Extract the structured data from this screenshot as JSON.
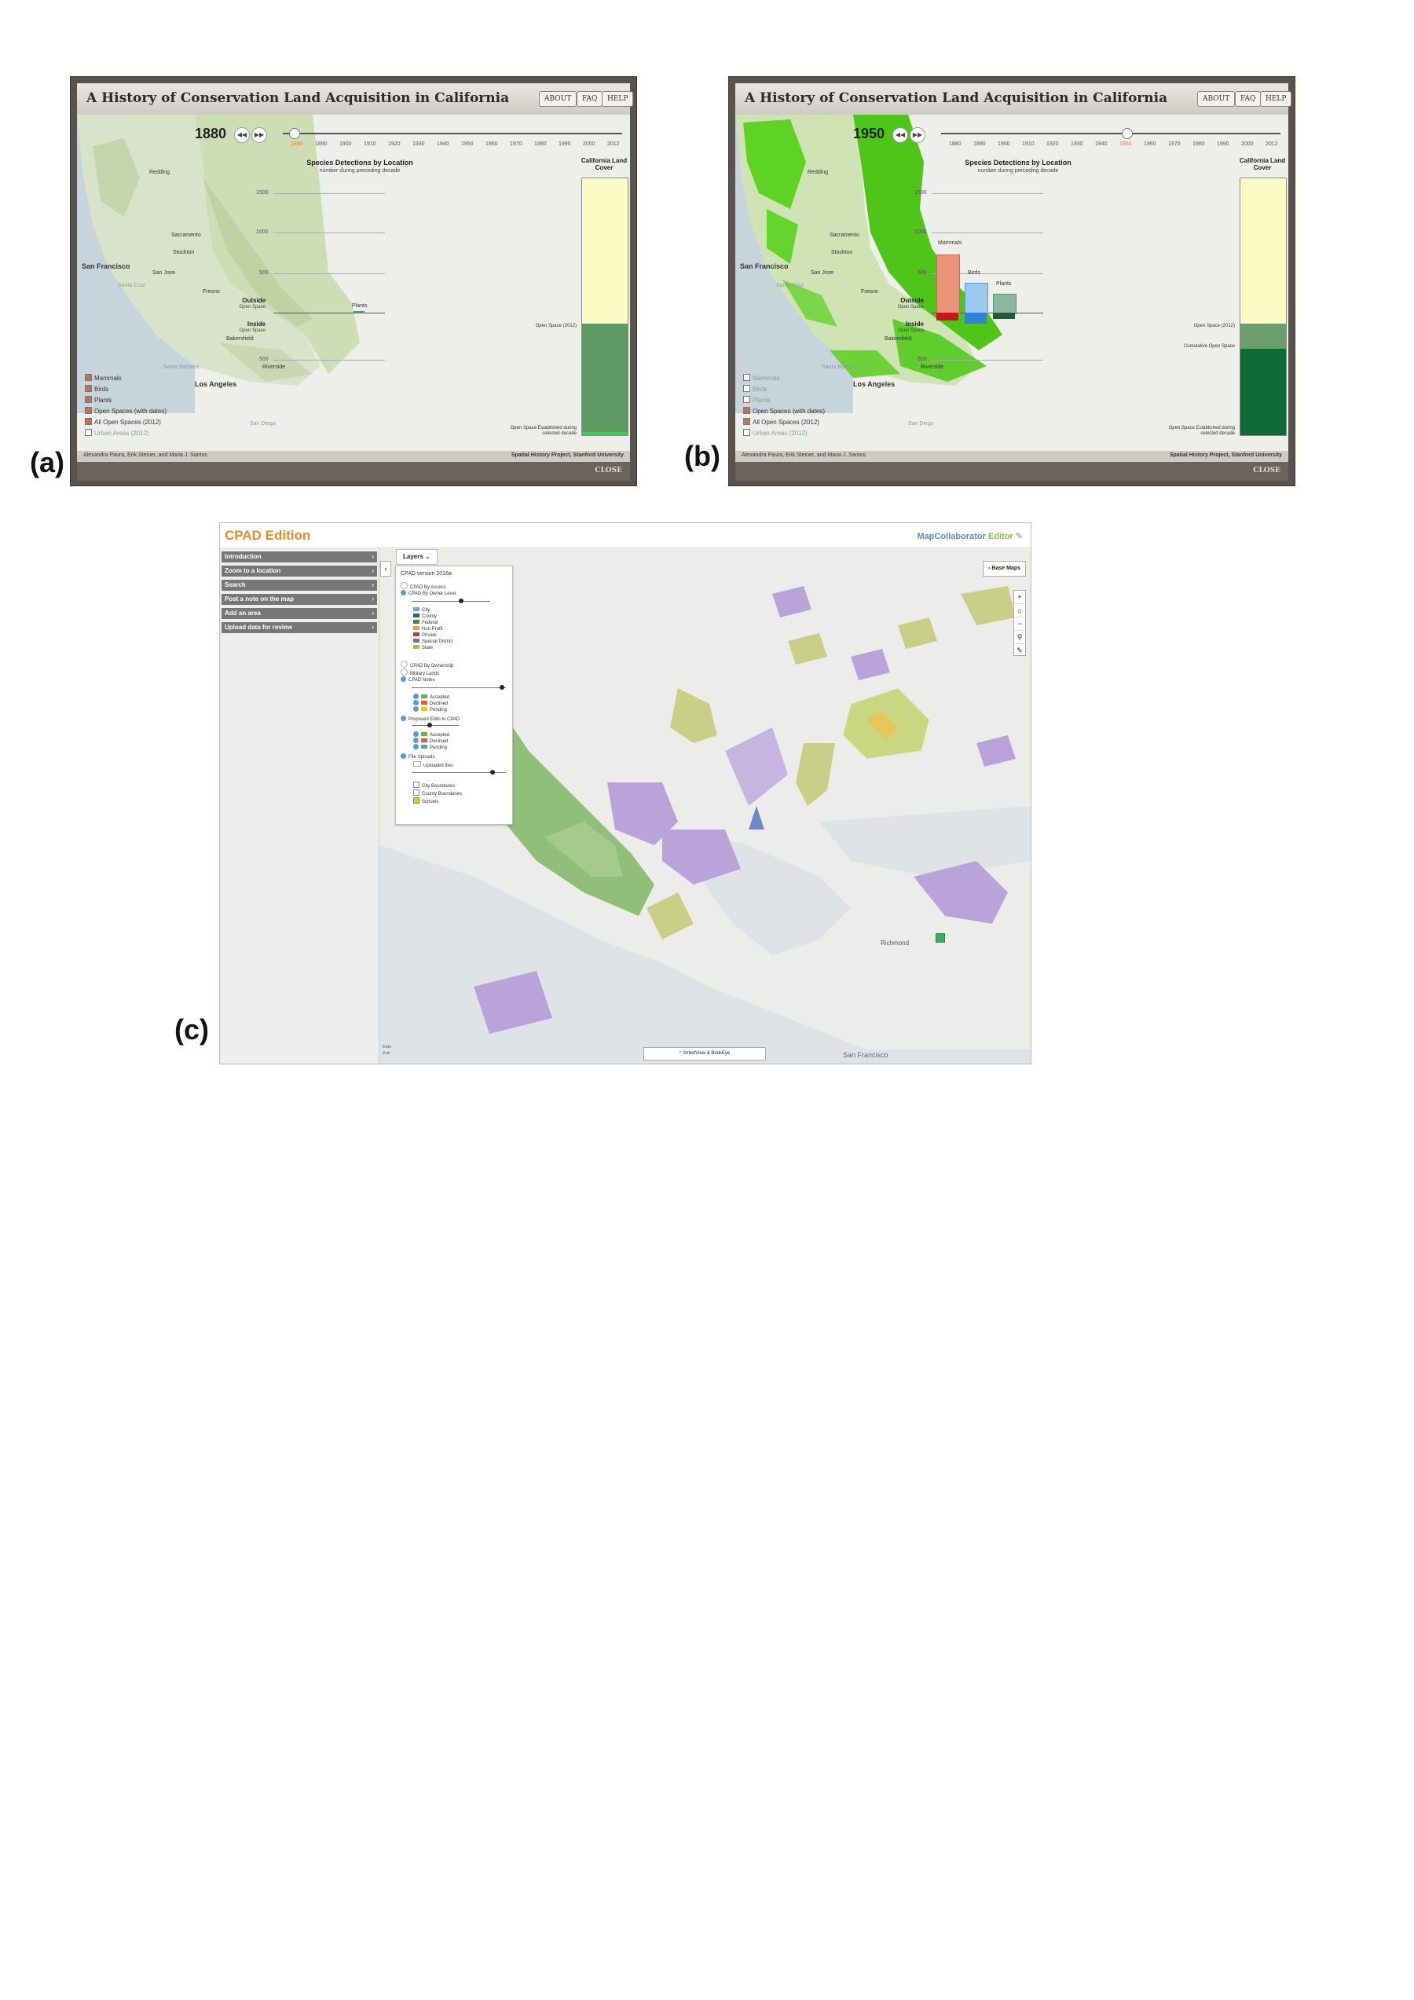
{
  "figure_labels": {
    "a": "(a)",
    "b": "(b)",
    "c": "(c)"
  },
  "history_app": {
    "title": "A History of Conservation Land Acquisition in California",
    "buttons": {
      "about": "ABOUT",
      "faq": "FAQ",
      "help": "HELP"
    },
    "prev_icon": "rewind-icon",
    "next_icon": "fast-forward-icon",
    "timeline_ticks": [
      "1880",
      "1890",
      "1900",
      "1910",
      "1920",
      "1930",
      "1940",
      "1950",
      "1960",
      "1970",
      "1980",
      "1990",
      "2000",
      "2012"
    ],
    "cities": {
      "redding": "Redding",
      "sacramento": "Sacramento",
      "stockton": "Stockton",
      "san_francisco": "San Francisco",
      "san_jose": "San Jose",
      "santa_cruz": "Santa Cruz",
      "fresno": "Fresno",
      "bakersfield": "Bakersfield",
      "santa_barbara": "Santa Barbara",
      "los_angeles": "Los Angeles",
      "riverside": "Riverside",
      "san_diego": "San Diego"
    },
    "legend": [
      "Mammals",
      "Birds",
      "Plants",
      "Open Spaces (with dates)",
      "All Open Spaces (2012)",
      "Urban Areas (2012)"
    ],
    "detections_title": "Species Detections by Location",
    "detections_subtitle": "number during preceding decade",
    "gridline_labels": [
      "1500",
      "1000",
      "500",
      "500"
    ],
    "outside_label": "Outside",
    "outside_sub": "Open Space",
    "inside_label": "Inside",
    "inside_sub": "Open Space",
    "land_cover_title": "California Land Cover",
    "open_space_2012": "Open Space (2012)",
    "cumulative_open_space": "Cumulative Open Space",
    "open_space_established": "Open Space Established during selected decade",
    "species": {
      "mammals": "Mammals",
      "birds": "Birds",
      "plants": "Plants"
    },
    "footer_left": "Alexandra Paura, Erik Steiner, and Maria J. Santos",
    "footer_right": "Spatial History Project, Stanford University",
    "close": "CLOSE",
    "panel_a": {
      "year": "1880"
    },
    "panel_b": {
      "year": "1950"
    }
  },
  "cpad": {
    "brand": "CPAD Edition",
    "map_collaborator": "MapCollaborator",
    "editor": "Editor",
    "nav": [
      "Introduction",
      "Zoom to a location",
      "Search",
      "Post a note on the map",
      "Add an area",
      "Upload data for review"
    ],
    "layers_button": "Layers",
    "base_maps": "Base Maps",
    "streetview": "StreetView & BirdsEye",
    "layers": {
      "version": "CPAD version 2016a",
      "by_access": "CPAD By Access",
      "by_owner_level": "CPAD By Owner Level",
      "owner_levels": [
        {
          "label": "City",
          "color": "#5cb7c7"
        },
        {
          "label": "County",
          "color": "#2d5aa8"
        },
        {
          "label": "Federal",
          "color": "#3a8c3a"
        },
        {
          "label": "Non Profit",
          "color": "#e4a437"
        },
        {
          "label": "Private",
          "color": "#c0392b"
        },
        {
          "label": "Special District",
          "color": "#9b59b6"
        },
        {
          "label": "State",
          "color": "#a7c13f"
        }
      ],
      "by_ownership": "CPAD By Ownership",
      "military": "Military Lands",
      "notes": "CPAD Notes",
      "note_states": [
        "Accepted",
        "Declined",
        "Pending"
      ],
      "proposed": "Proposed Edits to CPAD",
      "proposed_states": [
        "Accepted",
        "Declined",
        "Pending"
      ],
      "file_uploads": "File Uploads",
      "uploaded_files": "Uploaded files",
      "city_boundaries": "City Boundaries",
      "county_boundaries": "County Boundaries",
      "schools": "Schools"
    },
    "place_labels": {
      "san_francisco": "San Francisco",
      "richmond": "Richmond"
    },
    "scale": [
      "5 km",
      "3 mi"
    ],
    "colors": {
      "green": "#8fbf78",
      "purple": "#b9a3d9",
      "olive": "#c9cf86",
      "water": "#dfe3e6"
    }
  }
}
